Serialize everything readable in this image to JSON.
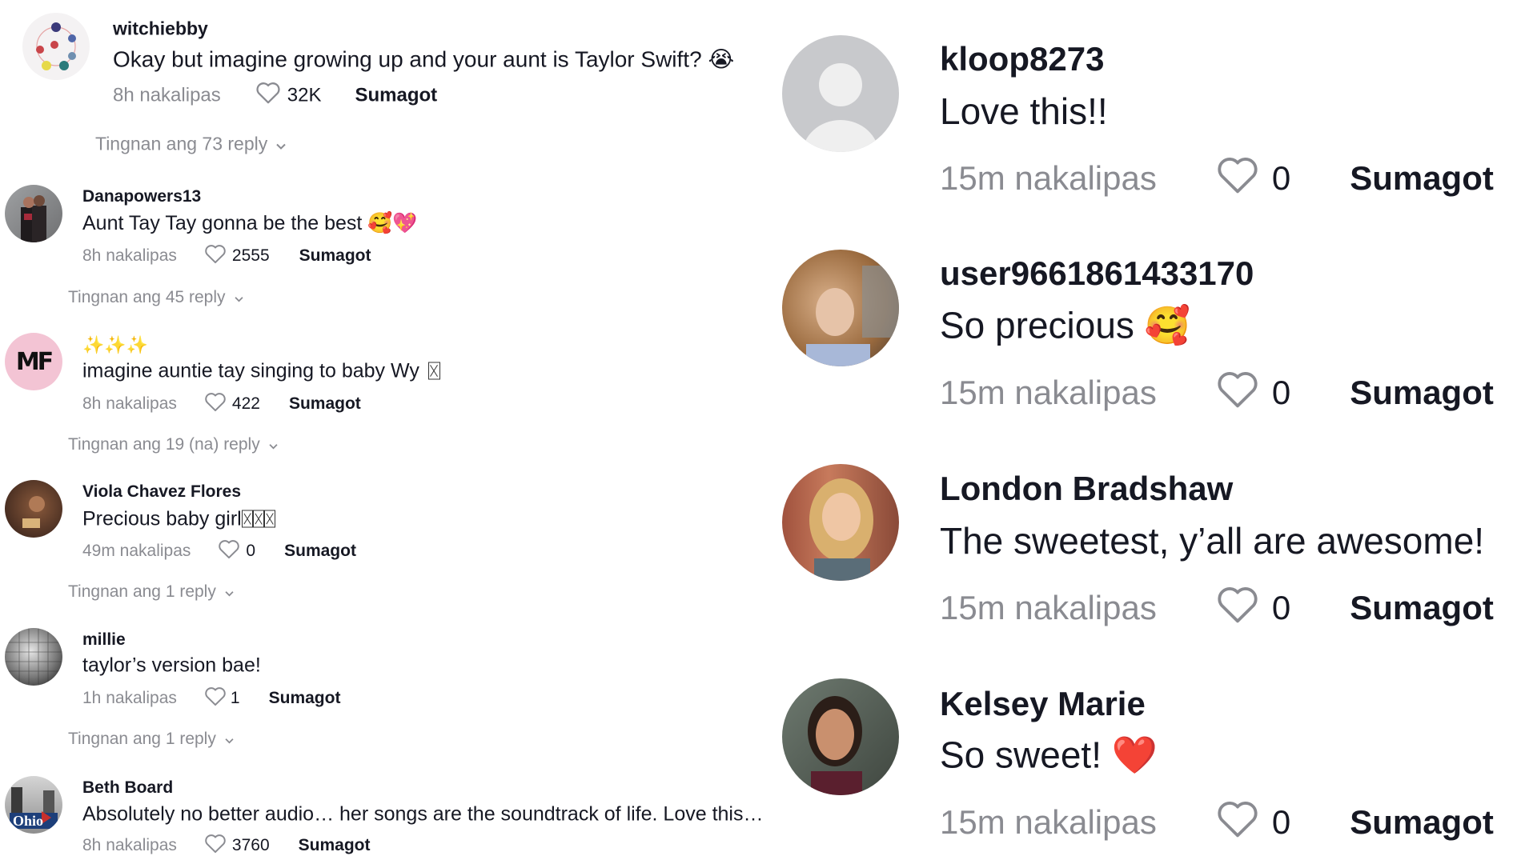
{
  "left_comments": [
    {
      "username": "witchiebby",
      "text": "Okay but imagine growing up and your aunt is Taylor Swift?",
      "emoji": "😭",
      "time": "8h nakalipas",
      "likes": "32K",
      "reply_label": "Sumagot",
      "view_replies": "Tingnan ang 73 reply",
      "avatar": "flower-circle-avatar"
    },
    {
      "username": "Danapowers13",
      "text": "Aunt Tay Tay gonna be the best",
      "emoji": "🥰💖",
      "time": "8h nakalipas",
      "likes": "2555",
      "reply_label": "Sumagot",
      "view_replies": "Tingnan ang 45 reply",
      "avatar": "photo-avatar"
    },
    {
      "username": "✨✨✨",
      "text": "imagine auntie tay singing to baby Wy",
      "time": "8h nakalipas",
      "likes": "422",
      "reply_label": "Sumagot",
      "view_replies": "Tingnan ang 19 (na) reply",
      "avatar_initials": "MF"
    },
    {
      "username": "Viola Chavez Flores",
      "text": "Precious baby girl",
      "time": "49m nakalipas",
      "likes": "0",
      "reply_label": "Sumagot",
      "view_replies": "Tingnan ang 1 reply",
      "avatar": "photo-avatar"
    },
    {
      "username": "millie",
      "text": "taylor’s version bae!",
      "time": "1h nakalipas",
      "likes": "1",
      "reply_label": "Sumagot",
      "view_replies": "Tingnan ang 1 reply",
      "avatar": "disco-ball-avatar"
    },
    {
      "username": "Beth Board",
      "text": "Absolutely no better audio… her songs are the soundtrack of life. Love this…",
      "time": "8h nakalipas",
      "likes": "3760",
      "reply_label": "Sumagot",
      "avatar": "photo-avatar",
      "avatar_text": "Ohio"
    }
  ],
  "right_comments": [
    {
      "username": "kloop8273",
      "text": "Love this!!",
      "emoji": "",
      "time": "15m nakalipas",
      "likes": "0",
      "reply_label": "Sumagot",
      "avatar": "default-avatar"
    },
    {
      "username": "user9661861433170",
      "text": "So precious",
      "emoji": "🥰",
      "time": "15m nakalipas",
      "likes": "0",
      "reply_label": "Sumagot",
      "avatar": "photo-avatar"
    },
    {
      "username": "London Bradshaw",
      "text": "The sweetest, y’all are awesome!",
      "emoji": "",
      "time": "15m nakalipas",
      "likes": "0",
      "reply_label": "Sumagot",
      "avatar": "photo-avatar"
    },
    {
      "username": "Kelsey Marie",
      "text": "So sweet!",
      "emoji": "❤️",
      "time": "15m nakalipas",
      "likes": "0",
      "reply_label": "Sumagot",
      "avatar": "photo-avatar"
    }
  ],
  "colors": {
    "text": "#161823",
    "muted": "#8a8b91",
    "heart_outline": "#8a8b91",
    "default_avatar_bg": "#c8c9cc",
    "mf_avatar_bg": "#f3c4d4"
  }
}
